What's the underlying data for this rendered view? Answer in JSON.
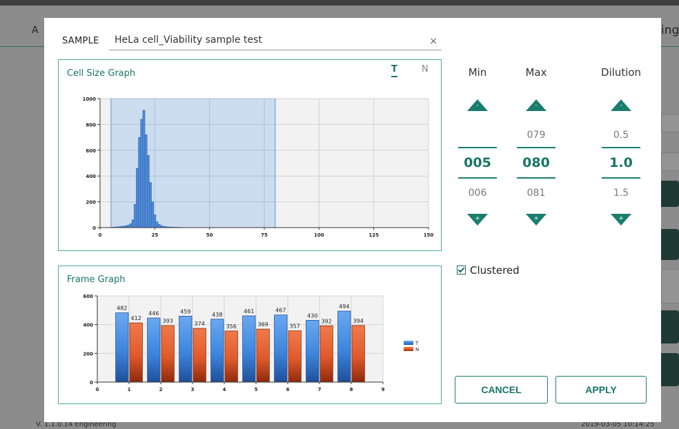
{
  "background": {
    "right_header_fragment": "ing",
    "left_header_fragment": "A",
    "version_text": "V. 1.1.0.14 Engineering",
    "datetime_text": "2019-03-05 10:14:25"
  },
  "sample": {
    "label": "SAMPLE",
    "value": "HeLa cell_Viability sample test",
    "clear_icon": "close-icon"
  },
  "cell_size_graph": {
    "title": "Cell Size Graph",
    "tabs": [
      {
        "label": "T",
        "active": true
      },
      {
        "label": "N",
        "active": false
      }
    ]
  },
  "frame_graph": {
    "title": "Frame Graph"
  },
  "spinners": {
    "min": {
      "label": "Min",
      "prev": "",
      "current": "005",
      "next": "006"
    },
    "max": {
      "label": "Max",
      "prev": "079",
      "current": "080",
      "next": "081"
    },
    "dilution": {
      "label": "Dilution",
      "prev": "0.5",
      "current": "1.0",
      "next": "1.5"
    },
    "up_icon": "triangle-up-icon",
    "down_icon": "triangle-down-icon",
    "up_mark": "-",
    "down_mark": "+"
  },
  "clustered": {
    "label": "Clustered",
    "checked": true
  },
  "buttons": {
    "cancel": "CANCEL",
    "apply": "APPLY"
  },
  "colors": {
    "accent": "#177567",
    "series_T": "#3d86de",
    "series_N": "#e05a2b",
    "histogram": "#4f8bd6",
    "selection": "#c7d9f0"
  },
  "chart_data": [
    {
      "type": "bar",
      "name": "cell_size",
      "x": [
        5,
        6,
        7,
        8,
        9,
        10,
        11,
        12,
        13,
        14,
        15,
        16,
        17,
        18,
        19,
        20,
        21,
        22,
        23,
        24,
        25,
        26,
        27,
        28,
        29,
        30,
        31,
        32,
        33,
        34,
        35,
        36,
        37,
        38,
        39,
        40
      ],
      "values": [
        2,
        3,
        5,
        6,
        8,
        10,
        12,
        15,
        20,
        30,
        60,
        180,
        460,
        700,
        840,
        910,
        720,
        560,
        350,
        200,
        100,
        45,
        25,
        15,
        10,
        8,
        6,
        5,
        4,
        3,
        3,
        2,
        2,
        1,
        1,
        1
      ],
      "xlim": [
        0,
        150
      ],
      "ylim": [
        0,
        1000
      ],
      "x_ticks": [
        "0",
        "25",
        "50",
        "75",
        "100",
        "125",
        "150"
      ],
      "y_ticks": [
        "0",
        "200",
        "400",
        "600",
        "800",
        "1000"
      ],
      "selection_range": [
        5,
        80
      ]
    },
    {
      "type": "bar",
      "name": "frame",
      "categories": [
        "1",
        "2",
        "3",
        "4",
        "5",
        "6",
        "7",
        "8"
      ],
      "series": [
        {
          "name": "T",
          "values": [
            482,
            446,
            459,
            438,
            461,
            467,
            430,
            494
          ]
        },
        {
          "name": "N",
          "values": [
            412,
            393,
            374,
            356,
            369,
            357,
            392,
            394
          ]
        }
      ],
      "xlim": [
        0,
        9
      ],
      "ylim": [
        0,
        600
      ],
      "x_ticks": [
        "0",
        "1",
        "2",
        "3",
        "4",
        "5",
        "6",
        "7",
        "8",
        "9"
      ],
      "y_ticks": [
        "0",
        "200",
        "400",
        "600"
      ],
      "legend": "right"
    }
  ]
}
